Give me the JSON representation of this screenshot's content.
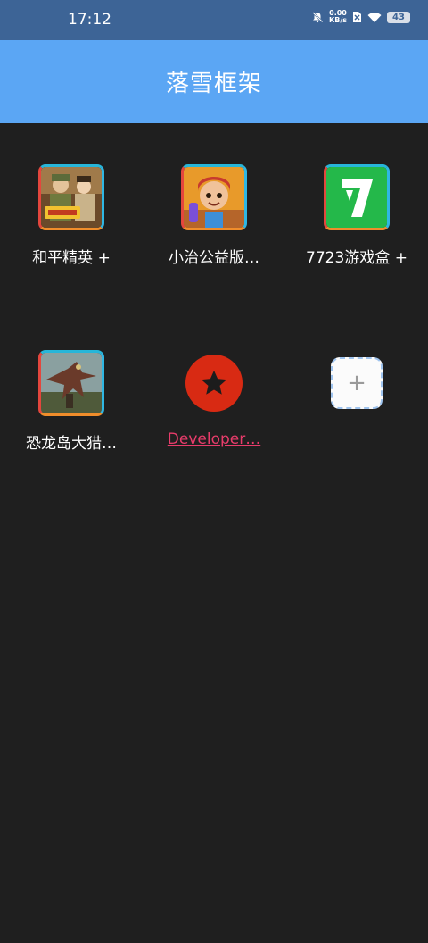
{
  "status_bar": {
    "time": "17:12",
    "net_speed_value": "0.00",
    "net_speed_unit": "KB/s",
    "battery": "43"
  },
  "app_bar": {
    "title": "落雪框架"
  },
  "apps": [
    {
      "label": "和平精英 +",
      "icon": "peace-elite-game-icon"
    },
    {
      "label": "小治公益版…",
      "icon": "subway-surfers-game-icon"
    },
    {
      "label": "7723游戏盒 +",
      "icon": "7723-game-box-icon"
    },
    {
      "label": "恐龙岛大猎…",
      "icon": "dinosaur-island-game-icon"
    },
    {
      "label": "Developer…",
      "icon": "star-icon"
    }
  ],
  "add_button": {
    "label": "+"
  },
  "colors": {
    "status_bar": "#3d6496",
    "app_bar": "#5ba6f4",
    "background": "#1f1f1f",
    "developer_link": "#e83c6b",
    "star_circle": "#d82a13"
  }
}
